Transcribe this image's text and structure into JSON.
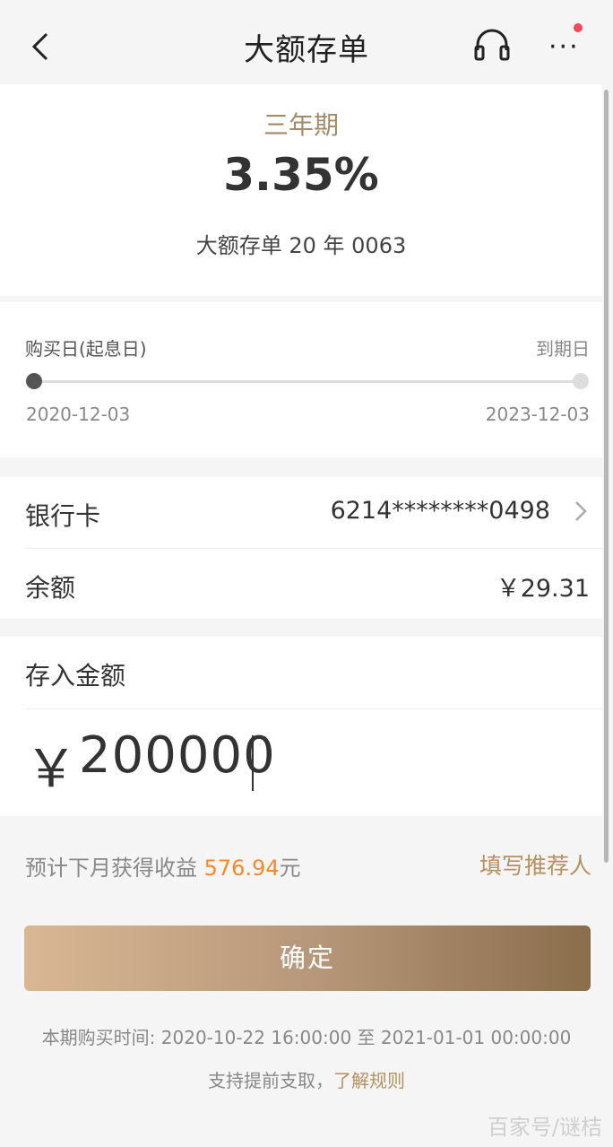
{
  "header": {
    "title": "大额存单"
  },
  "product": {
    "term": "三年期",
    "rate": "3.35%",
    "name": "大额存单 20 年 0063"
  },
  "dates": {
    "start_label": "购买日(起息日)",
    "end_label": "到期日",
    "start_date": "2020-12-03",
    "end_date": "2023-12-03"
  },
  "account": {
    "card_label": "银行卡",
    "card_number": "6214********0498",
    "balance_label": "余额",
    "balance_value": "￥29.31"
  },
  "deposit": {
    "label": "存入金额",
    "currency_symbol": "￥",
    "amount": "200000"
  },
  "income": {
    "prefix": "预计下月获得收益 ",
    "value": "576.94",
    "suffix": "元",
    "referrer_link": "填写推荐人"
  },
  "confirm_button": "确定",
  "footer": {
    "period": "本期购买时间: 2020-10-22 16:00:00 至 2021-01-01 00:00:00",
    "rules_prefix": "支持提前支取，",
    "rules_link": "了解规则"
  },
  "watermark": "百家号/谜桔",
  "colors": {
    "accent_gold": "#b6905f",
    "income_orange": "#f5892d",
    "notification_red": "#f04858"
  },
  "icons": {
    "back": "back-arrow-icon",
    "service": "headset-icon",
    "more": "more-icon",
    "chevron": "chevron-right-icon"
  }
}
